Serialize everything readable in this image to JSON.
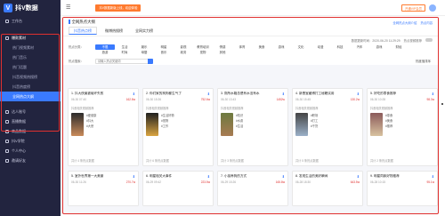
{
  "app": {
    "logo_mark": "V",
    "logo_text": "抖V数据"
  },
  "topbar": {
    "menu_icon": "menu-icon",
    "notice": "抖V数据新版上线，欢迎体验",
    "trial": "开通VIP会员",
    "avatar": "avatar"
  },
  "sidebar": {
    "items": [
      {
        "label": "工作台"
      },
      {
        "label": "爆款素材"
      }
    ],
    "sub_items": [
      {
        "label": "热门视频素材"
      },
      {
        "label": "热门音乐"
      },
      {
        "label": "热门话题"
      },
      {
        "label": "抖音视频热搜榜"
      },
      {
        "label": "抖音热度榜"
      },
      {
        "label": "全网热点大纲"
      }
    ],
    "bottom_items": [
      {
        "label": "达人账号"
      },
      {
        "label": "直播数据"
      },
      {
        "label": "商品数据"
      },
      {
        "label": "抖V学院"
      },
      {
        "label": "个人中心"
      },
      {
        "label": "邀请好友"
      }
    ],
    "accent": "#3a7afe",
    "bg": "#22243f"
  },
  "main": {
    "title": "全网热点大纲",
    "help_links": [
      "全网热点大纲介绍",
      "热点内容"
    ],
    "tabs": [
      {
        "label": "抖音热点榜"
      },
      {
        "label": "微博热搜榜"
      },
      {
        "label": "全网实力榜"
      }
    ],
    "update_time": "数据更新时间：2020-06-20 11:29:29",
    "toggle_label": "热点视频推荐",
    "category_label": "热点分类：",
    "categories": [
      "不限",
      "生活",
      "娱乐",
      "明星",
      "影视",
      "教育培训",
      "情感",
      "体育",
      "美食",
      "游戏",
      "文化",
      "动漫",
      "科技",
      "汽车",
      "游戏",
      "财经",
      "旅游",
      "时尚",
      "母婴",
      "音乐",
      "政务",
      "宠物",
      "其他"
    ],
    "search_label": "热点搜索：",
    "search_placeholder": "请输入热点关键词",
    "sort_text": "热度值排序"
  },
  "cards": [
    {
      "title": "1. 抖大侠竟被破坏失败",
      "date": "06-30 07:40",
      "heat": "162.8w",
      "sub": "抖音相关视频推荐",
      "tags": [
        "#爱健康",
        "#抖大",
        "#大侠"
      ],
      "foot": "共计 4 条热点数据"
    },
    {
      "title": "2. 你们家的狗狗都生气了",
      "date": "06-30 15:26",
      "heat": "752.6w",
      "sub": "抖音相关视频推荐",
      "tags": [
        "#生活好物",
        "#宠物",
        "#工作"
      ],
      "foot": "共计 6 条热点数据"
    },
    {
      "title": "3. 厕所水箱总是有水没有水",
      "date": "06-30 13:43",
      "heat": "1452w",
      "sub": "抖音相关视频推荐",
      "tags": [
        "#知识",
        "#水费",
        "#生活"
      ],
      "foot": "共计 3 条热点数据"
    },
    {
      "title": "4. 新晋宝藏博打工秘籍实用",
      "date": "06-30 15:45",
      "heat": "130.2w",
      "sub": "抖音相关视频推荐",
      "tags": [
        "#职场",
        "#打工",
        "#干货"
      ],
      "foot": "共计 5 条热点数据"
    },
    {
      "title": "5. 好吃的零食推荐",
      "date": "06-30 10:28",
      "heat": "98.3w",
      "sub": "抖音相关视频推荐",
      "tags": [
        "#零食",
        "#美食",
        "#推荐"
      ],
      "foot": "共计 2 条热点数据"
    },
    {
      "title": "5. 室外世界第一大美景",
      "date": "06-30 11:26",
      "heat": "270.7w",
      "foot": ""
    },
    {
      "title": "6. 明星相关大事件",
      "date": "06-29 09:42",
      "heat": "223.5w",
      "foot": ""
    },
    {
      "title": "7. 小孩养狗的方式",
      "date": "06-29 15:26",
      "heat": "165.8w",
      "foot": ""
    },
    {
      "title": "8. 发现生活的美好瞬间",
      "date": "06-28 18:30",
      "heat": "643.5w",
      "foot": ""
    },
    {
      "title": "9. 明星同款好物推荐",
      "date": "06-28 10:15",
      "heat": "95.1w",
      "foot": ""
    }
  ],
  "colors": {
    "heat": "#e0302f",
    "highlight_box": "#e0302f",
    "notice": "#ff7a2e"
  }
}
